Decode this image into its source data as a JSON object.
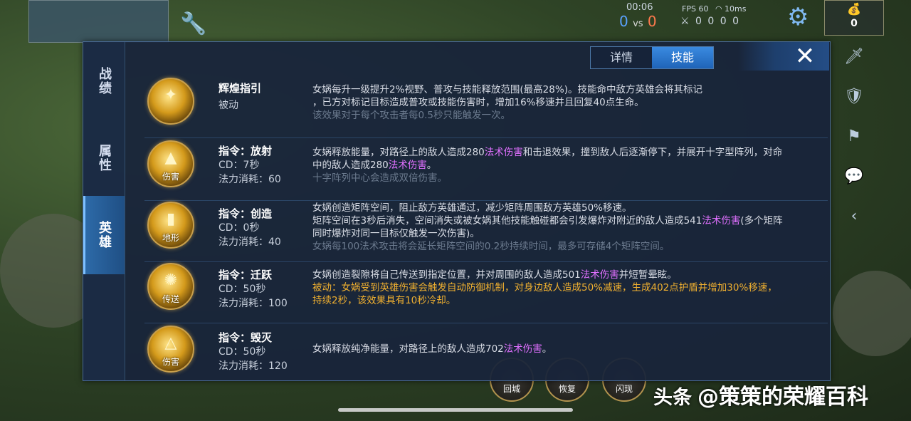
{
  "hud": {
    "timer": "00:06",
    "score_blue": "0",
    "vs": "vs",
    "score_red": "0",
    "fps": "FPS 60",
    "ping": "10ms",
    "kda": "0 0 0 0",
    "gold": "0"
  },
  "bottom_buttons": [
    "回城",
    "恢复",
    "闪现"
  ],
  "watermark": {
    "prefix": "头条",
    "text": "@策策的荣耀百科"
  },
  "left_tabs": [
    {
      "label": "战绩",
      "active": false
    },
    {
      "label": "属性",
      "active": false
    },
    {
      "label": "英雄",
      "active": true
    }
  ],
  "top_tabs": [
    {
      "label": "详情",
      "active": false
    },
    {
      "label": "技能",
      "active": true
    }
  ],
  "close_icon": "close-x",
  "skills": [
    {
      "name": "辉煌指引",
      "meta1": "被动",
      "meta2": "",
      "icon_tag": "",
      "desc_line1": "女娲每升一级提升2%视野、普攻与技能释放范围(最高28%)。技能命中敌方英雄会将其标记",
      "desc_line2": "，已方对标记目标造成普攻或技能伤害时，增加16%移速并且回复40点生命。",
      "desc_extra": "该效果对于每个攻击者每0.5秒只能触发一次。"
    },
    {
      "name": "指令：放射",
      "meta1": "CD：7秒",
      "meta2": "法力消耗：60",
      "icon_tag": "伤害",
      "desc_a": "女娲释放能量，对路径上的敌人造成280",
      "desc_mag1": "法术伤害",
      "desc_b": "和击退效果，撞到敌人后逐渐停下，并展开十字型阵列，对命",
      "desc_c": "中的敌人造成280",
      "desc_mag2": "法术伤害",
      "desc_d": "。",
      "desc_extra": "十字阵列中心会造成双倍伤害。"
    },
    {
      "name": "指令：创造",
      "meta1": "CD：0秒",
      "meta2": "法力消耗：40",
      "icon_tag": "地形",
      "desc_line1": "女娲创造矩阵空间，阻止敌方英雄通过，减少矩阵周围敌方英雄50%移速。",
      "desc_a": "矩阵空间在3秒后消失，空间消失或被女娲其他技能触碰都会引发爆炸对附近的敌人造成541",
      "desc_mag": "法术伤害",
      "desc_b": "(多个矩阵",
      "desc_c": "同时爆炸对同一目标仅触发一次伤害)。",
      "desc_extra": "女娲每100法术攻击将会延长矩阵空间的0.2秒持续时间，最多可存储4个矩阵空间。"
    },
    {
      "name": "指令：迁跃",
      "meta1": "CD：50秒",
      "meta2": "法力消耗：100",
      "icon_tag": "传送",
      "desc_a": "女娲创造裂隙将自己传送到指定位置，并对周围的敌人造成501",
      "desc_mag": "法术伤害",
      "desc_b": "并短暂晕眩。",
      "desc_passive1": "被动：女娲受到英雄伤害会触发自动防御机制，对身边敌人造成50%减速，生成402点护盾并增加30%移速，",
      "desc_passive2": "持续2秒，该效果具有10秒冷却。"
    },
    {
      "name": "指令：毁灭",
      "meta1": "CD：50秒",
      "meta2": "法力消耗：120",
      "icon_tag": "伤害",
      "desc_a": "女娲释放纯净能量，对路径上的敌人造成702",
      "desc_mag": "法术伤害",
      "desc_b": "。"
    }
  ]
}
